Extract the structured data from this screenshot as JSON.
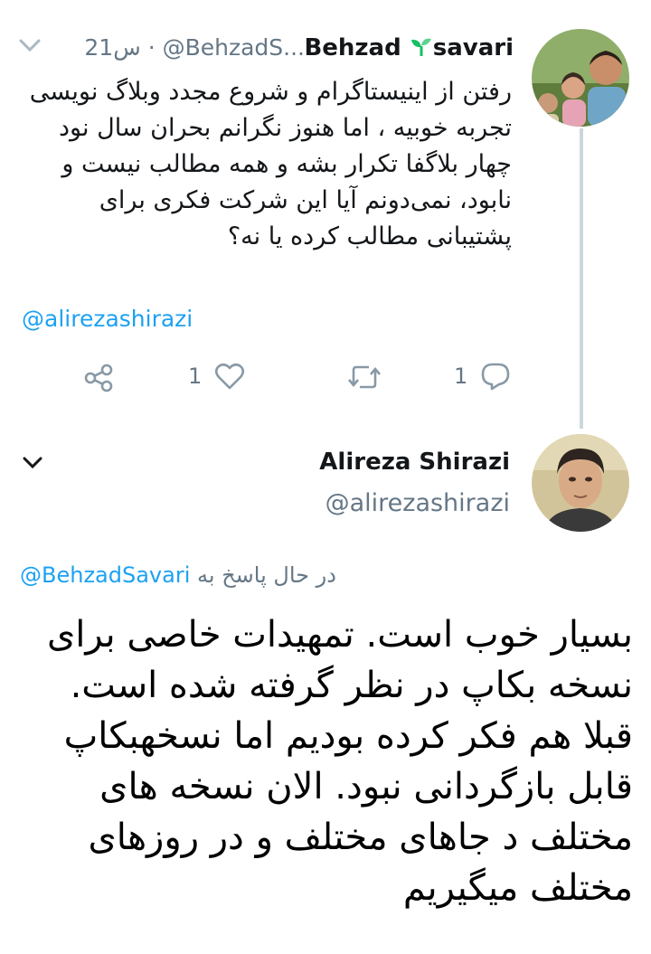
{
  "tweet1": {
    "display_name": "Behzad",
    "name_suffix": "savari",
    "handle": "@BehzadS...",
    "separator": "·",
    "time": "21س",
    "text": "رفتن از اینیستاگرام و شروع مجدد وبلاگ نویسی تجربه خوبیه ، اما هنوز نگرانم بحران سال نود چهار بلاگفا تکرار بشه و همه مطالب نیست و نابود، نمی‌دونم آیا این شرکت فکری برای پشتیبانی مطالب کرده یا نه؟",
    "mention": "@alirezashirazi",
    "actions": {
      "like_count": "1",
      "reply_count": "1"
    }
  },
  "tweet2": {
    "display_name": "Alireza Shirazi",
    "handle": "@alirezashirazi",
    "replying_to_prefix": "در حال پاسخ به",
    "replying_to_handle": "@BehzadSavari",
    "text": "بسیار خوب است. تمهیدات خاصی برای نسخه بکاپ در نظر گرفته شده است. قبلا هم فکر کرده بودیم اما نسخهبکاپ قابل بازگردانی نبود. الان نسخه های مختلف د جاهای مختلف و در روزهای مختلف میگیریم"
  },
  "colors": {
    "link": "#1da1f2",
    "meta": "#657786",
    "thread_line": "#ccd6dd",
    "like_red": "#e0245e",
    "sprout_green": "#17bf63"
  },
  "icons": [
    "chevron-down-icon",
    "sprout-emoji-icon",
    "share-icon",
    "heart-icon",
    "retweet-icon",
    "reply-icon"
  ]
}
